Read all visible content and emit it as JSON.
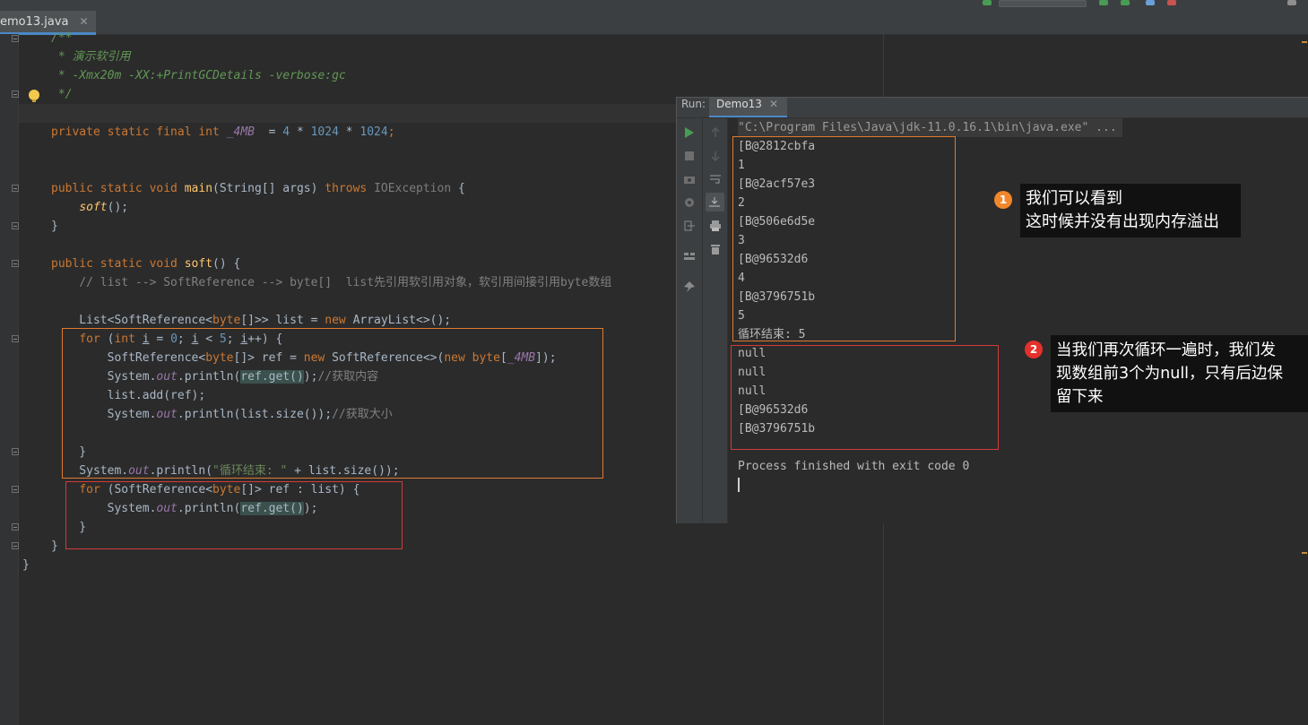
{
  "editor": {
    "tab_label": "emo13.java",
    "lines": [
      {
        "segs": [
          [
            "cm",
            "/**"
          ]
        ]
      },
      {
        "segs": [
          [
            "cm",
            " * 演示软引用"
          ]
        ]
      },
      {
        "segs": [
          [
            "cm",
            " * -Xmx20m -XX:+PrintGCDetails -verbose:gc"
          ]
        ]
      },
      {
        "segs": [
          [
            "cm",
            " */"
          ]
        ]
      },
      {
        "segs": []
      },
      {
        "segs": [
          [
            "kw",
            "private static final int "
          ],
          [
            "const",
            "_4MB"
          ],
          [
            "",
            "  = "
          ],
          [
            "num",
            "4"
          ],
          [
            "",
            " * "
          ],
          [
            "num",
            "1024"
          ],
          [
            "",
            " * "
          ],
          [
            "num",
            "1024"
          ],
          [
            "kw",
            ";"
          ]
        ]
      },
      {
        "segs": []
      },
      {
        "segs": []
      },
      {
        "segs": [
          [
            "kw",
            "public static void "
          ],
          [
            "fn",
            "main"
          ],
          [
            "",
            "(String[] args) "
          ],
          [
            "kw",
            "throws "
          ],
          [
            "gray",
            "IOException"
          ],
          [
            "",
            " {"
          ]
        ]
      },
      {
        "segs": [
          [
            "",
            "    "
          ],
          [
            "fn itl",
            "soft"
          ],
          [
            "",
            "();"
          ]
        ]
      },
      {
        "segs": [
          [
            "",
            "}"
          ]
        ]
      },
      {
        "segs": []
      },
      {
        "segs": [
          [
            "kw",
            "public static void "
          ],
          [
            "fn",
            "soft"
          ],
          [
            "",
            "() {"
          ]
        ]
      },
      {
        "segs": [
          [
            "lc",
            "    // list --> SoftReference --> byte[]  list先引用软引用对象，软引用间接引用byte数组"
          ]
        ]
      },
      {
        "segs": []
      },
      {
        "segs": [
          [
            "",
            "    List<SoftReference<"
          ],
          [
            "kw",
            "byte"
          ],
          [
            "",
            "[]>> list = "
          ],
          [
            "kw",
            "new "
          ],
          [
            "",
            "ArrayList<>();"
          ]
        ]
      },
      {
        "segs": [
          [
            "",
            "    "
          ],
          [
            "kw",
            "for "
          ],
          [
            "",
            "("
          ],
          [
            "kw",
            "int "
          ],
          [
            "ul",
            "i"
          ],
          [
            "",
            " = "
          ],
          [
            "num",
            "0"
          ],
          [
            "",
            "; "
          ],
          [
            "ul",
            "i"
          ],
          [
            "",
            " < "
          ],
          [
            "num",
            "5"
          ],
          [
            "",
            "; "
          ],
          [
            "ul",
            "i"
          ],
          [
            "",
            "++) {"
          ]
        ]
      },
      {
        "segs": [
          [
            "",
            "        SoftReference<"
          ],
          [
            "kw",
            "byte"
          ],
          [
            "",
            "[]> ref = "
          ],
          [
            "kw",
            "new "
          ],
          [
            "",
            "SoftReference<>("
          ],
          [
            "kw",
            "new byte"
          ],
          [
            "",
            "["
          ],
          [
            "const",
            "_4MB"
          ],
          [
            "",
            "]);"
          ]
        ]
      },
      {
        "segs": [
          [
            "",
            "        System."
          ],
          [
            "fld",
            "out"
          ],
          [
            "",
            ".println("
          ],
          [
            "hl",
            "ref.get()"
          ],
          [
            "",
            ");"
          ],
          [
            "lc",
            "//获取内容"
          ]
        ]
      },
      {
        "segs": [
          [
            "",
            "        list.add(ref);"
          ]
        ]
      },
      {
        "segs": [
          [
            "",
            "        System."
          ],
          [
            "fld",
            "out"
          ],
          [
            "",
            ".println(list.size());"
          ],
          [
            "lc",
            "//获取大小"
          ]
        ]
      },
      {
        "segs": []
      },
      {
        "segs": [
          [
            "",
            "    }"
          ]
        ]
      },
      {
        "segs": [
          [
            "",
            "    System."
          ],
          [
            "fld",
            "out"
          ],
          [
            "",
            ".println("
          ],
          [
            "str",
            "\"循环结束: \""
          ],
          [
            "",
            " + list.size());"
          ]
        ]
      },
      {
        "segs": [
          [
            "",
            "    "
          ],
          [
            "kw",
            "for "
          ],
          [
            "",
            "(SoftReference<"
          ],
          [
            "kw",
            "byte"
          ],
          [
            "",
            "[]> ref : list) {"
          ]
        ]
      },
      {
        "segs": [
          [
            "",
            "        System."
          ],
          [
            "fld",
            "out"
          ],
          [
            "",
            ".println("
          ],
          [
            "hl",
            "ref.get()"
          ],
          [
            "",
            ");"
          ]
        ]
      },
      {
        "segs": [
          [
            "",
            "    }"
          ]
        ]
      },
      {
        "segs": [
          [
            "",
            "}"
          ]
        ]
      },
      {
        "segs": [
          [
            "",
            "}"
          ]
        ]
      }
    ]
  },
  "run_panel": {
    "label": "Run:",
    "tab": "Demo13",
    "command": "\"C:\\Program Files\\Java\\jdk-11.0.16.1\\bin\\java.exe\" ...",
    "output": [
      "[B@2812cbfa",
      "1",
      "[B@2acf57e3",
      "2",
      "[B@506e6d5e",
      "3",
      "[B@96532d6",
      "4",
      "[B@3796751b",
      "5",
      "循环结束: 5",
      "null",
      "null",
      "null",
      "[B@96532d6",
      "[B@3796751b",
      "",
      "Process finished with exit code 0"
    ]
  },
  "annotations": [
    {
      "number": "1",
      "color": "#f0872b",
      "text_lines": [
        "我们可以看到",
        "这时候并没有出现内存溢出"
      ]
    },
    {
      "number": "2",
      "color": "#e5312c",
      "text_lines": [
        "当我们再次循环一遍时，我们发",
        "现数组前3个为null，只有后边保",
        "留下来"
      ]
    }
  ],
  "colors": {
    "orange_box": "#e07a2e",
    "red_box": "#d23b3b"
  }
}
